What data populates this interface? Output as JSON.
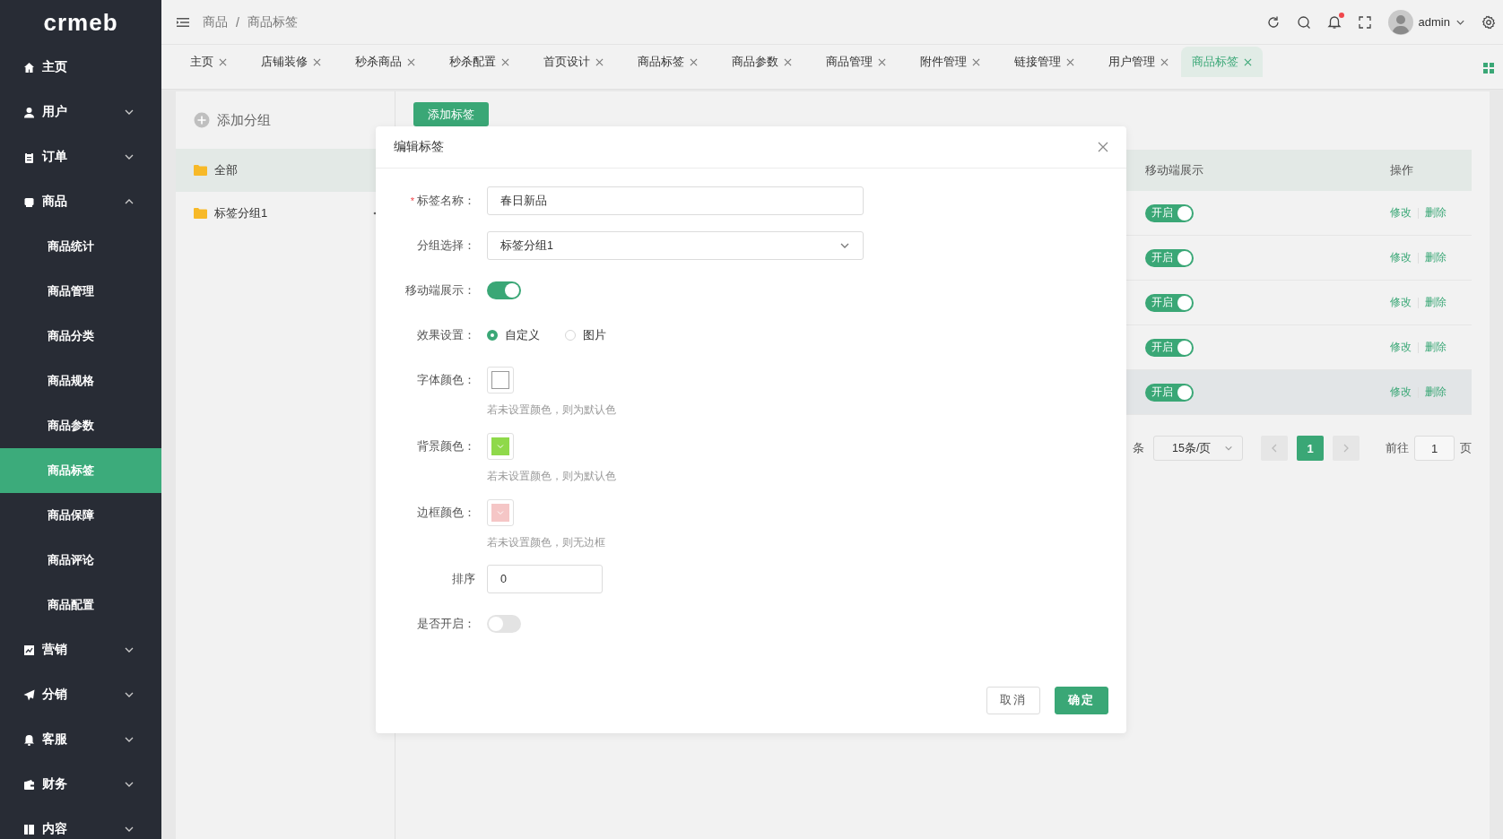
{
  "sidebar": {
    "logo": "crmeb",
    "items": [
      {
        "label": "主页"
      },
      {
        "label": "用户",
        "expanded": false
      },
      {
        "label": "订单",
        "expanded": false
      },
      {
        "label": "商品",
        "expanded": true,
        "children": [
          {
            "label": "商品统计",
            "selected": false
          },
          {
            "label": "商品管理",
            "selected": false
          },
          {
            "label": "商品分类",
            "selected": false
          },
          {
            "label": "商品规格",
            "selected": false
          },
          {
            "label": "商品参数",
            "selected": false
          },
          {
            "label": "商品标签",
            "selected": true
          },
          {
            "label": "商品保障",
            "selected": false
          },
          {
            "label": "商品评论",
            "selected": false
          },
          {
            "label": "商品配置",
            "selected": false
          }
        ]
      },
      {
        "label": "营销",
        "expanded": false
      },
      {
        "label": "分销",
        "expanded": false
      },
      {
        "label": "客服",
        "expanded": false
      },
      {
        "label": "财务",
        "expanded": false
      },
      {
        "label": "内容",
        "expanded": false
      }
    ]
  },
  "header": {
    "breadcrumb": [
      "商品",
      "商品标签"
    ],
    "separator": "/",
    "user": "admin",
    "notification": true
  },
  "tabs": [
    {
      "label": "主页",
      "selected": false
    },
    {
      "label": "店铺装修",
      "selected": false
    },
    {
      "label": "秒杀商品",
      "selected": false
    },
    {
      "label": "秒杀配置",
      "selected": false
    },
    {
      "label": "首页设计",
      "selected": false
    },
    {
      "label": "商品标签",
      "selected": false
    },
    {
      "label": "商品参数",
      "selected": false
    },
    {
      "label": "商品管理",
      "selected": false
    },
    {
      "label": "附件管理",
      "selected": false
    },
    {
      "label": "链接管理",
      "selected": false
    },
    {
      "label": "用户管理",
      "selected": false
    },
    {
      "label": "商品标签",
      "selected": true
    }
  ],
  "groups_panel": {
    "add_group": "添加分组",
    "groups": [
      {
        "label": "全部",
        "selected": true
      },
      {
        "label": "标签分组1",
        "selected": false,
        "has_menu": true
      }
    ]
  },
  "tags_panel": {
    "add_button": "添加标签",
    "table": {
      "columns": [
        "移动端展示",
        "操作"
      ],
      "rows": [
        {
          "mobile": {
            "label": "开启",
            "on": true
          },
          "actions": [
            "修改",
            "删除"
          ],
          "highlighted": false
        },
        {
          "mobile": {
            "label": "开启",
            "on": true
          },
          "actions": [
            "修改",
            "删除"
          ],
          "highlighted": false
        },
        {
          "mobile": {
            "label": "开启",
            "on": true
          },
          "actions": [
            "修改",
            "删除"
          ],
          "highlighted": false
        },
        {
          "mobile": {
            "label": "开启",
            "on": true
          },
          "actions": [
            "修改",
            "删除"
          ],
          "highlighted": false
        },
        {
          "mobile": {
            "label": "开启",
            "on": true
          },
          "actions": [
            "修改",
            "删除"
          ],
          "highlighted": true
        }
      ]
    },
    "pagination": {
      "total_suffix": "条",
      "page_size": "15条/页",
      "pages": [
        {
          "label": "1",
          "selected": true
        }
      ],
      "goto_label": "前往",
      "goto_value": "1",
      "page_suffix": "页"
    }
  },
  "modal": {
    "title": "编辑标签",
    "required_mark": "*",
    "fields": [
      {
        "kind": "text",
        "label": "标签名称：",
        "required": true,
        "value": "春日新品"
      },
      {
        "kind": "select",
        "label": "分组选择：",
        "value": "标签分组1"
      },
      {
        "kind": "switch",
        "label": "移动端展示：",
        "on": true
      },
      {
        "kind": "radio",
        "label": "效果设置：",
        "options": [
          {
            "label": "自定义",
            "selected": true
          },
          {
            "label": "图片",
            "selected": false
          }
        ]
      },
      {
        "kind": "color",
        "label": "字体颜色：",
        "hint": "若未设置颜色，则为默认色"
      },
      {
        "kind": "color",
        "label": "背景颜色：",
        "color": "#8fd94a",
        "hint": "若未设置颜色，则为默认色"
      },
      {
        "kind": "color",
        "label": "边框颜色：",
        "color": "#f5c6c6",
        "hint": "若未设置颜色，则无边框"
      },
      {
        "kind": "number",
        "label": "排序",
        "value": "0"
      },
      {
        "kind": "switch",
        "label": "是否开启：",
        "on": false
      }
    ],
    "buttons": [
      {
        "label": "取消",
        "primary": false
      },
      {
        "label": "确定",
        "primary": true
      }
    ]
  }
}
